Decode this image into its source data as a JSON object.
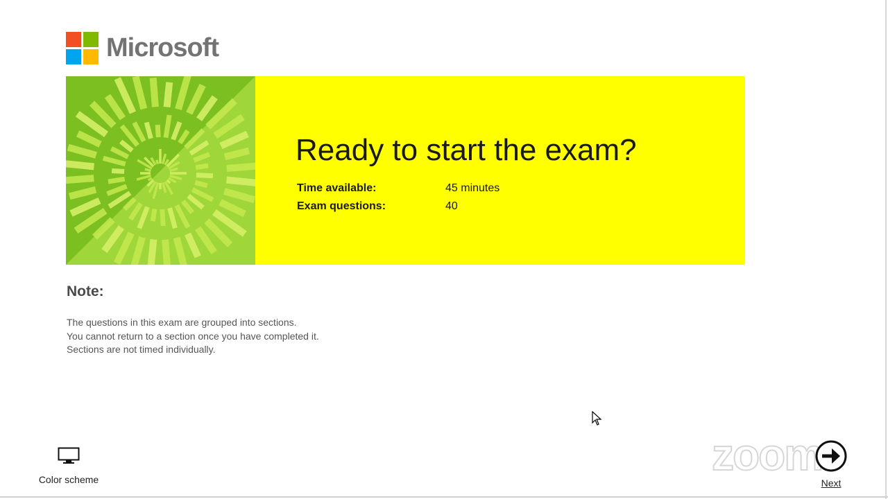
{
  "logo": {
    "text": "Microsoft",
    "colors": [
      "#f25022",
      "#7fba00",
      "#00a4ef",
      "#ffb900"
    ]
  },
  "banner": {
    "title": "Ready to start the exam?",
    "background": "#ffff00",
    "time_label": "Time available:",
    "time_value": "45 minutes",
    "questions_label": "Exam questions:",
    "questions_value": "40"
  },
  "note": {
    "title": "Note:",
    "lines": [
      "The questions in this exam are grouped into sections.",
      "You cannot return to a section once you have completed it.",
      "Sections are not timed individually."
    ]
  },
  "footer": {
    "color_scheme_label": "Color scheme",
    "color_scheme_icon": "monitor-icon",
    "next_label": "Next",
    "next_icon": "arrow-right-circle-icon"
  },
  "watermark": {
    "text": "zoom"
  }
}
